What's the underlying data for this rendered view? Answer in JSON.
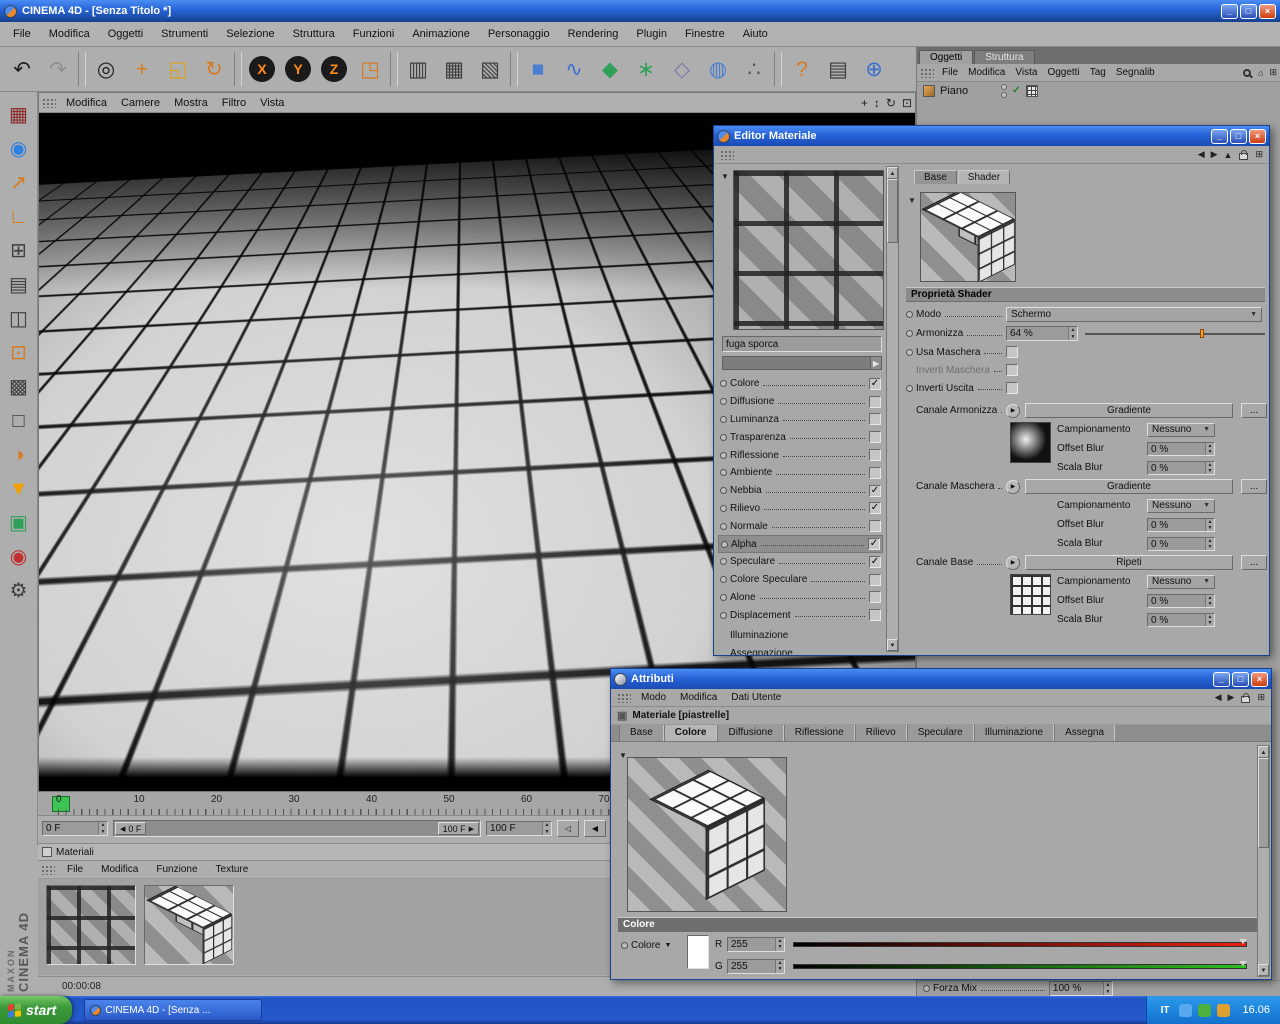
{
  "titlebar": {
    "title": "CINEMA 4D - [Senza Titolo *]"
  },
  "menubar": [
    "File",
    "Modifica",
    "Oggetti",
    "Strumenti",
    "Selezione",
    "Struttura",
    "Funzioni",
    "Animazione",
    "Personaggio",
    "Rendering",
    "Plugin",
    "Finestre",
    "Aiuto"
  ],
  "toolbar": {
    "buttons": [
      {
        "name": "undo-icon",
        "glyph": "↶",
        "color": "#1f1f1f"
      },
      {
        "name": "redo-icon",
        "glyph": "↷",
        "color": "#8f8f8f"
      },
      {
        "name": "toolbar-separator",
        "sep": true
      },
      {
        "name": "live-selection-icon",
        "glyph": "◎",
        "color": "#1f1f1f"
      },
      {
        "name": "move-tool-icon",
        "glyph": "+",
        "color": "#d87a1e",
        "big": true
      },
      {
        "name": "scale-tool-icon",
        "glyph": "◱",
        "color": "#d8a31e"
      },
      {
        "name": "rotate-tool-icon",
        "glyph": "↻",
        "color": "#d87a1e"
      },
      {
        "name": "toolbar-separator",
        "sep": true
      },
      {
        "name": "lock-x-icon",
        "glyph": "X",
        "round": true
      },
      {
        "name": "lock-y-icon",
        "glyph": "Y",
        "round": true
      },
      {
        "name": "lock-z-icon",
        "glyph": "Z",
        "round": true
      },
      {
        "name": "coord-system-icon",
        "glyph": "◳",
        "color": "#d87a1e"
      },
      {
        "name": "toolbar-separator",
        "sep": true
      },
      {
        "name": "render-view-icon",
        "glyph": "▥",
        "color": "#3f3f3f"
      },
      {
        "name": "render-picture-viewer-icon",
        "glyph": "▦",
        "color": "#3f3f3f"
      },
      {
        "name": "render-settings-icon",
        "glyph": "▧",
        "color": "#3f3f3f"
      },
      {
        "name": "toolbar-separator",
        "sep": true
      },
      {
        "name": "add-primitive-icon",
        "glyph": "■",
        "color": "#4a7ed2"
      },
      {
        "name": "add-spline-icon",
        "glyph": "∿",
        "color": "#3a6fd0"
      },
      {
        "name": "add-nurbs-icon",
        "glyph": "◆",
        "color": "#2fa05a"
      },
      {
        "name": "add-modeling-icon",
        "glyph": "∗",
        "color": "#2fa05a"
      },
      {
        "name": "add-deformer-icon",
        "glyph": "◇",
        "color": "#7a7aa8"
      },
      {
        "name": "add-environment-icon",
        "glyph": "◍",
        "color": "#4a7ed2"
      },
      {
        "name": "add-particles-icon",
        "glyph": "∴",
        "color": "#555555"
      },
      {
        "name": "toolbar-separator",
        "sep": true
      },
      {
        "name": "help-icon",
        "glyph": "?",
        "color": "#d87a1e"
      },
      {
        "name": "content-browser-icon",
        "glyph": "▤",
        "color": "#3f3f3f"
      },
      {
        "name": "online-updater-icon",
        "glyph": "⊕",
        "color": "#3a6fd0"
      }
    ]
  },
  "left_toolbar": {
    "buttons": [
      {
        "name": "layout-icon",
        "glyph": "▦",
        "color": "#8a2a2a"
      },
      {
        "name": "world-grid-icon",
        "glyph": "◉",
        "color": "#2d7fe0"
      },
      {
        "name": "object-up-icon",
        "glyph": "↗",
        "color": "#d87a1e"
      },
      {
        "name": "axis-icon",
        "glyph": "∟",
        "color": "#d87a1e"
      },
      {
        "name": "grid-icon",
        "glyph": "⊞",
        "color": "#3f3f3f"
      },
      {
        "name": "array-icon",
        "glyph": "▤",
        "color": "#3f3f3f"
      },
      {
        "name": "panes-icon",
        "glyph": "◫",
        "color": "#3f3f3f"
      },
      {
        "name": "workplane-icon",
        "glyph": "⊡",
        "color": "#d87a1e"
      },
      {
        "name": "checker-icon",
        "glyph": "▩",
        "color": "#3f3f3f"
      },
      {
        "name": "selection-frame-icon",
        "glyph": "□",
        "color": "#3f3f3f"
      },
      {
        "name": "sphere-tool-icon",
        "glyph": "◑",
        "color": "#d87a1e"
      },
      {
        "name": "drop-to-floor-icon",
        "glyph": "▼",
        "color": "#f0a000"
      },
      {
        "name": "cubes-icon",
        "glyph": "▣",
        "color": "#2fa05a"
      },
      {
        "name": "material-sphere-icon",
        "glyph": "◉",
        "color": "#c03030"
      },
      {
        "name": "settings-gear-icon",
        "glyph": "⚙",
        "color": "#3f3f3f"
      }
    ]
  },
  "viewport": {
    "menus": [
      "Modifica",
      "Camere",
      "Mostra",
      "Filtro",
      "Vista"
    ]
  },
  "right_panel": {
    "tabs": [
      {
        "label": "Oggetti",
        "active": true
      },
      {
        "label": "Struttura"
      }
    ],
    "menus": [
      "File",
      "Modifica",
      "Vista",
      "Oggetti",
      "Tag",
      "Segnalib"
    ],
    "objects": [
      {
        "name": "Piano"
      }
    ],
    "forza_mix_label": "Forza Mix",
    "forza_mix_value": "100 %"
  },
  "material_editor": {
    "title": "Editor Materiale",
    "texture_name": "fuga sporca",
    "tabs": [
      {
        "label": "Base"
      },
      {
        "label": "Shader",
        "active": true
      }
    ],
    "channels": [
      {
        "label": "Colore",
        "checked": true
      },
      {
        "label": "Diffusione",
        "checked": false
      },
      {
        "label": "Luminanza",
        "checked": false
      },
      {
        "label": "Trasparenza",
        "checked": false
      },
      {
        "label": "Riflessione",
        "checked": false
      },
      {
        "label": "Ambiente",
        "checked": false
      },
      {
        "label": "Nebbia",
        "checked": true
      },
      {
        "label": "Rilievo",
        "checked": true
      },
      {
        "label": "Normale",
        "checked": false
      },
      {
        "label": "Alpha",
        "checked": true,
        "selected": true
      },
      {
        "label": "Speculare",
        "checked": true
      },
      {
        "label": "Colore Speculare",
        "checked": false
      },
      {
        "label": "Alone",
        "checked": false
      },
      {
        "label": "Displacement",
        "checked": false
      }
    ],
    "sections": [
      "Illuminazione",
      "Assegnazione"
    ],
    "props_title": "Proprietà Shader",
    "modo_label": "Modo",
    "modo_value": "Schermo",
    "armonizza_label": "Armonizza",
    "armonizza_value": "64 %",
    "armonizza_pct": "64%",
    "usa_maschera_label": "Usa Maschera",
    "inverti_maschera_label": "Inverti Maschera",
    "inverti_uscita_label": "Inverti Uscita",
    "groups": [
      {
        "label": "Canale Armonizza",
        "button": "Gradiente",
        "more": "...",
        "campionamento_label": "Campionamento",
        "campionamento_value": "Nessuno",
        "offset_label": "Offset Blur",
        "offset_value": "0 %",
        "scala_label": "Scala Blur",
        "scala_value": "0 %"
      },
      {
        "label": "Canale Maschera",
        "button": "Gradiente",
        "more": "...",
        "campionamento_label": "Campionamento",
        "campionamento_value": "Nessuno",
        "offset_label": "Offset Blur",
        "offset_value": "0 %",
        "scala_label": "Scala Blur",
        "scala_value": "0 %"
      },
      {
        "label": "Canale Base",
        "button": "Ripeti",
        "more": "...",
        "campionamento_label": "Campionamento",
        "campionamento_value": "Nessuno",
        "offset_label": "Offset Blur",
        "offset_value": "0 %",
        "scala_label": "Scala Blur",
        "scala_value": "0 %"
      }
    ]
  },
  "attributi": {
    "title": "Attributi",
    "menus": [
      "Modo",
      "Modifica",
      "Dati Utente"
    ],
    "material_label": "Materiale [piastrelle]",
    "tabs": [
      {
        "label": "Base"
      },
      {
        "label": "Colore",
        "active": true
      },
      {
        "label": "Diffusione"
      },
      {
        "label": "Riflessione"
      },
      {
        "label": "Rilievo"
      },
      {
        "label": "Speculare"
      },
      {
        "label": "Illuminazione"
      },
      {
        "label": "Assegna"
      }
    ],
    "section_title": "Colore",
    "color_label": "Colore",
    "r_label": "R",
    "r_value": "255",
    "g_label": "G",
    "g_value": "255"
  },
  "timeline": {
    "ticks": [
      "0",
      "10",
      "20",
      "30",
      "40",
      "50",
      "60",
      "70"
    ],
    "current_frame": "0 F",
    "range_start": "0 F",
    "range_end": "100 F",
    "end_frame": "100 F"
  },
  "materials_panel": {
    "title": "Materiali",
    "menus": [
      "File",
      "Modifica",
      "Funzione",
      "Texture"
    ],
    "time": "00:00:08"
  },
  "brand": {
    "maxon": "MAXON",
    "c4d": "CINEMA 4D"
  },
  "taskbar": {
    "start": "start",
    "task": "CINEMA 4D - [Senza ...",
    "lang": "IT",
    "clock": "16.06"
  }
}
